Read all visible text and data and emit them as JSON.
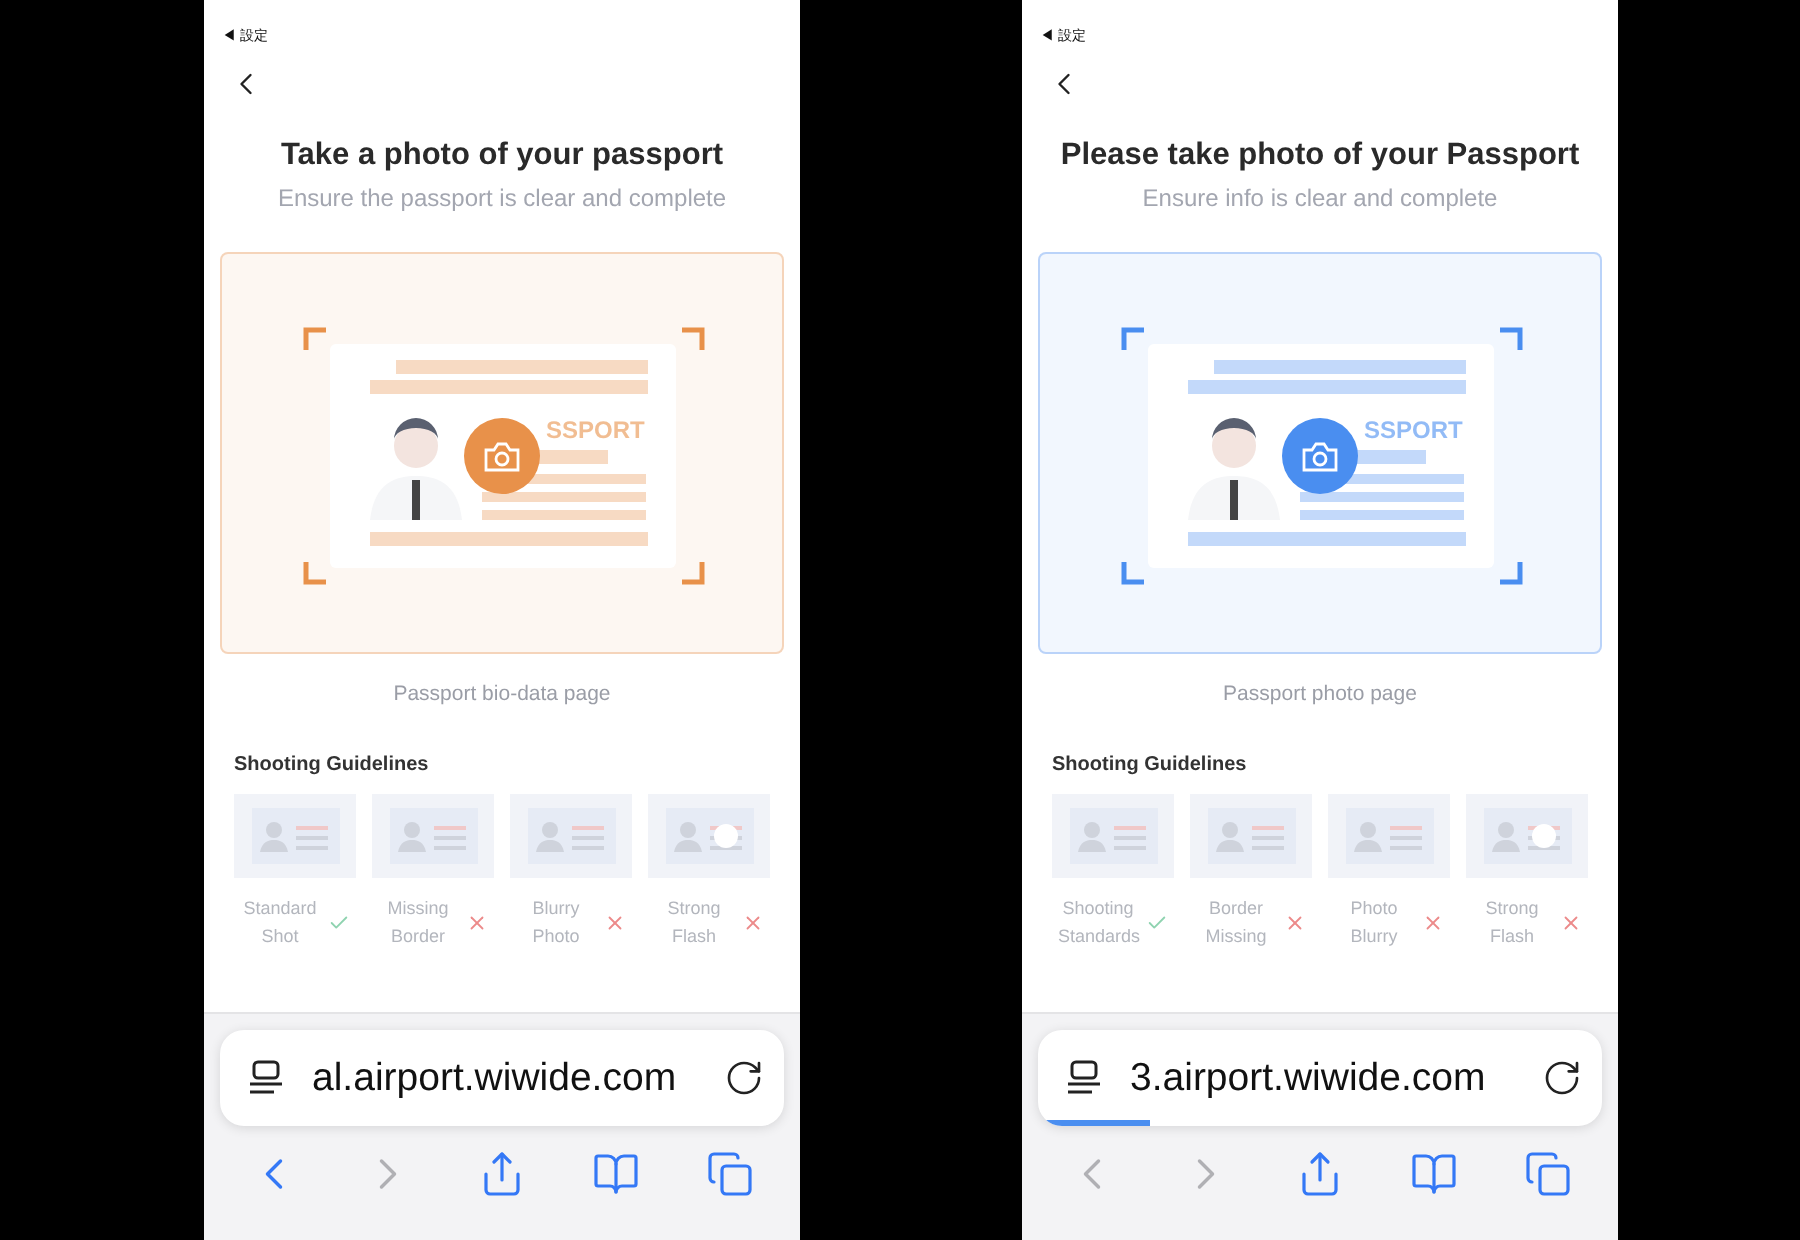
{
  "phones": [
    {
      "color": "#e8914a",
      "status_back": "◀ 設定",
      "title": "Take a photo of your passport",
      "subtitle": "Ensure the passport is clear and complete",
      "illustration_label": "SSPORT",
      "caption": "Passport bio-data page",
      "guidelines_title": "Shooting Guidelines",
      "guidelines": [
        {
          "label": "Standard Shot",
          "passed": true
        },
        {
          "label": "Missing Border",
          "passed": false
        },
        {
          "label": "Blurry Photo",
          "passed": false
        },
        {
          "label": "Strong Flash",
          "passed": false
        }
      ],
      "url": "al.airport.wiwide.com",
      "nav": [
        {
          "kind": "back",
          "disabled": false
        },
        {
          "kind": "forward",
          "disabled": true
        },
        {
          "kind": "share",
          "disabled": false
        },
        {
          "kind": "bookmarks",
          "disabled": false
        },
        {
          "kind": "tabs",
          "disabled": false
        }
      ]
    },
    {
      "color": "#4a8ef0",
      "status_back": "◀ 設定",
      "title": "Please take photo of your Passport",
      "subtitle": "Ensure info is clear and complete",
      "illustration_label": "SSPORT",
      "caption": "Passport photo page",
      "guidelines_title": "Shooting Guidelines",
      "guidelines": [
        {
          "label": "Shooting Standards",
          "passed": true
        },
        {
          "label": "Border Missing",
          "passed": false
        },
        {
          "label": "Photo Blurry",
          "passed": false
        },
        {
          "label": "Strong Flash",
          "passed": false
        }
      ],
      "url": "3.airport.wiwide.com",
      "progress": {
        "level": 0.2
      },
      "nav": [
        {
          "kind": "back",
          "disabled": true
        },
        {
          "kind": "forward",
          "disabled": true
        },
        {
          "kind": "share",
          "disabled": false
        },
        {
          "kind": "bookmarks",
          "disabled": false
        },
        {
          "kind": "tabs",
          "disabled": false
        }
      ]
    }
  ]
}
